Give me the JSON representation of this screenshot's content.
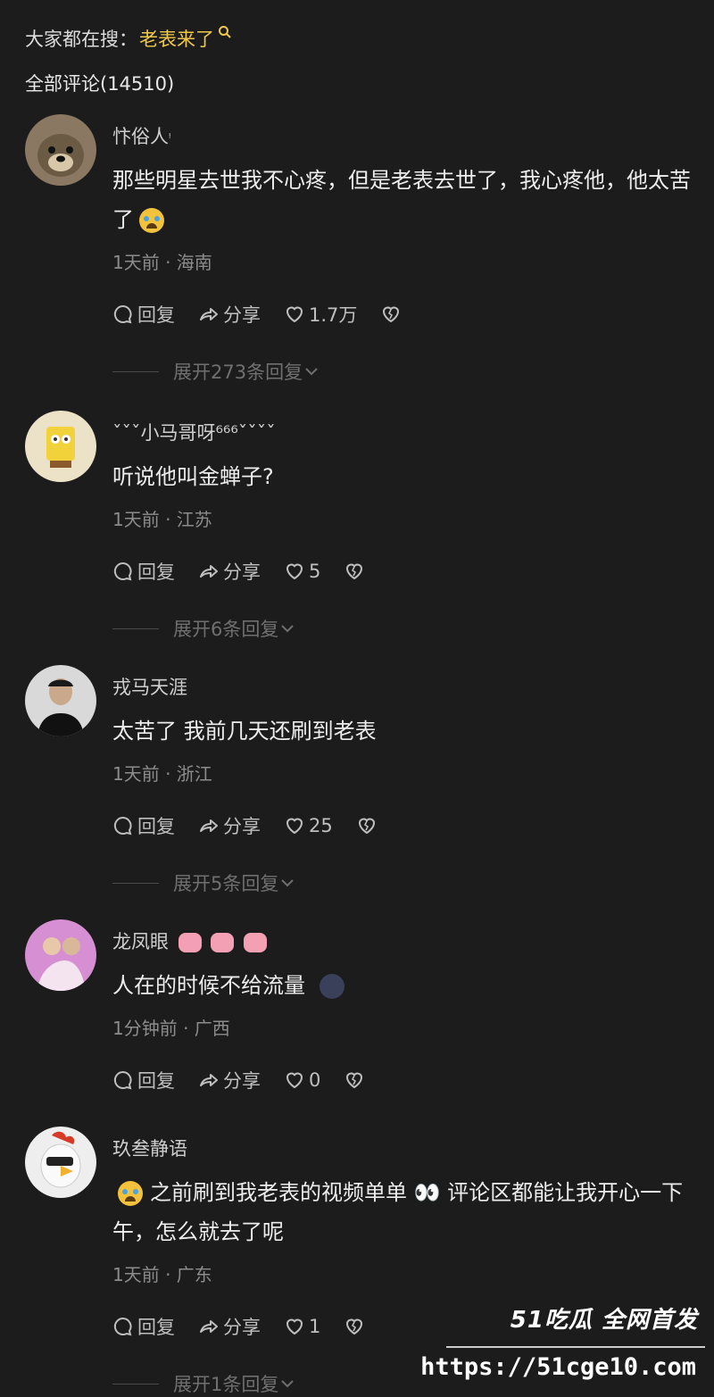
{
  "search": {
    "prefix": "大家都在搜：",
    "keyword": "老表来了"
  },
  "comments_header": "全部评论(14510)",
  "labels": {
    "reply": "回复",
    "share": "分享"
  },
  "comments": [
    {
      "user": "忭俗人",
      "user_badge": "ᵎ",
      "text": "那些明星去世我不心疼，但是老表去世了，我心疼他，他太苦了",
      "time": "1天前 · 海南",
      "likes": "1.7万",
      "expand": "展开273条回复",
      "avatar_color": "#6b5a44"
    },
    {
      "user": "ˇˇˇ小马哥呀⁶⁶⁶ˇˇˇˇ",
      "user_badge": "",
      "text": "听说他叫金蝉子?",
      "time": "1天前 · 江苏",
      "likes": "5",
      "expand": "展开6条回复",
      "avatar_color": "#e8dcc0"
    },
    {
      "user": "戎马天涯",
      "user_badge": "",
      "text": "太苦了 我前几天还刷到老表",
      "time": "1天前 · 浙江",
      "likes": "25",
      "expand": "展开5条回复",
      "avatar_color": "#2a2a2a"
    },
    {
      "user": "龙凤眼",
      "user_badge": "",
      "text": "人在的时候不给流量",
      "time": "1分钟前 · 广西",
      "likes": "0",
      "expand": "",
      "avatar_color": "#c884c8"
    },
    {
      "user": "玖叁静语",
      "user_badge": "",
      "text": "之前刷到我老表的视频单单 👀 评论区都能让我开心一下午，怎么就去了呢",
      "time": "1天前 · 广东",
      "likes": "1",
      "expand": "展开1条回复",
      "avatar_color": "#e6e6e6"
    }
  ],
  "watermark": {
    "top": "51吃瓜 全网首发",
    "url": "https://51cge10.com"
  }
}
